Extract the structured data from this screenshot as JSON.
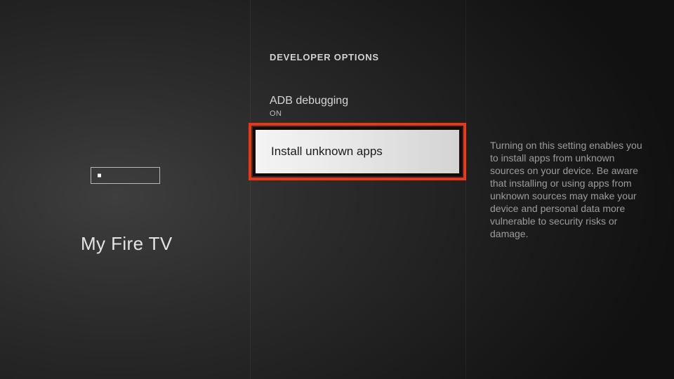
{
  "left": {
    "title": "My Fire TV"
  },
  "middle": {
    "section_heading": "DEVELOPER OPTIONS",
    "items": [
      {
        "label": "ADB debugging",
        "status": "ON"
      },
      {
        "label": "Install unknown apps"
      }
    ]
  },
  "right": {
    "description": "Turning on this setting enables you to install apps from un­known sources on your device. Be aware that installing or us­ing apps from unknown sources may make your device and personal data more vulnerable to security risks or damage."
  }
}
